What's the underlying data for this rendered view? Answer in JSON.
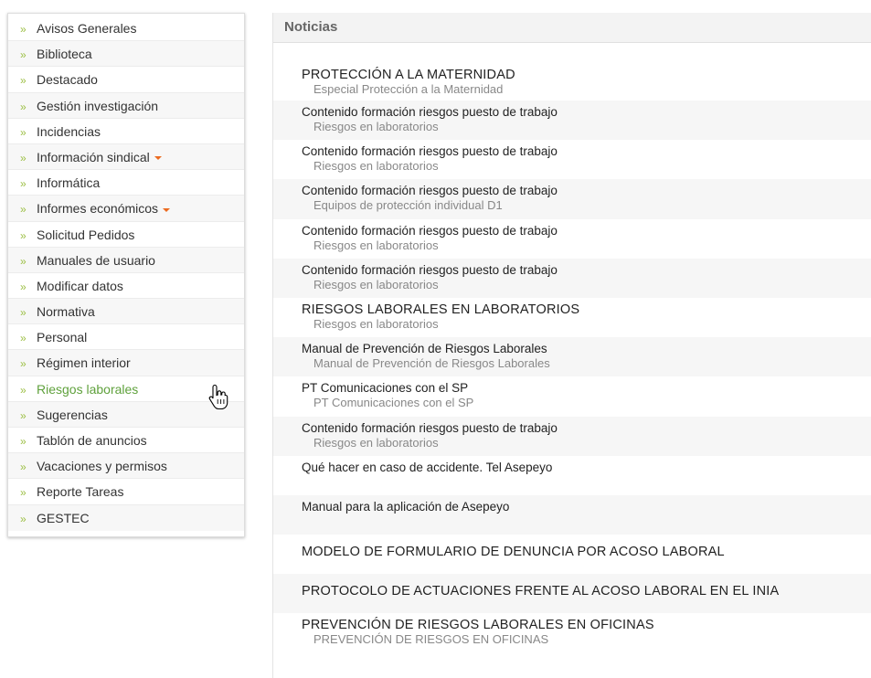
{
  "sidebar": {
    "items": [
      {
        "label": "Avisos Generales",
        "dropdown": false,
        "active": false
      },
      {
        "label": "Biblioteca",
        "dropdown": false,
        "active": false
      },
      {
        "label": "Destacado",
        "dropdown": false,
        "active": false
      },
      {
        "label": "Gestión investigación",
        "dropdown": false,
        "active": false
      },
      {
        "label": "Incidencias",
        "dropdown": false,
        "active": false
      },
      {
        "label": "Información sindical",
        "dropdown": true,
        "active": false
      },
      {
        "label": "Informática",
        "dropdown": false,
        "active": false
      },
      {
        "label": "Informes económicos",
        "dropdown": true,
        "active": false
      },
      {
        "label": "Solicitud Pedidos",
        "dropdown": false,
        "active": false
      },
      {
        "label": "Manuales de usuario",
        "dropdown": false,
        "active": false
      },
      {
        "label": "Modificar datos",
        "dropdown": false,
        "active": false
      },
      {
        "label": "Normativa",
        "dropdown": false,
        "active": false
      },
      {
        "label": "Personal",
        "dropdown": false,
        "active": false
      },
      {
        "label": "Régimen interior",
        "dropdown": false,
        "active": false
      },
      {
        "label": "Riesgos laborales",
        "dropdown": false,
        "active": true
      },
      {
        "label": "Sugerencias",
        "dropdown": false,
        "active": false
      },
      {
        "label": "Tablón de anuncios",
        "dropdown": false,
        "active": false
      },
      {
        "label": "Vacaciones y permisos",
        "dropdown": false,
        "active": false
      },
      {
        "label": "Reporte Tareas",
        "dropdown": false,
        "active": false
      },
      {
        "label": "GESTEC",
        "dropdown": false,
        "active": false
      }
    ],
    "bullet": "»"
  },
  "news": {
    "header": "Noticias",
    "items": [
      {
        "title": "PROTECCIÓN A LA MATERNIDAD",
        "subtitle": "Especial Protección a la Maternidad",
        "caps": true,
        "shaded": false
      },
      {
        "title": "Contenido formación riesgos puesto de trabajo",
        "subtitle": "Riesgos en laboratorios",
        "caps": false,
        "shaded": true
      },
      {
        "title": "Contenido formación riesgos puesto de trabajo",
        "subtitle": "Riesgos en laboratorios",
        "caps": false,
        "shaded": false
      },
      {
        "title": "Contenido formación riesgos puesto de trabajo",
        "subtitle": "Equipos de protección individual D1",
        "caps": false,
        "shaded": true
      },
      {
        "title": "Contenido formación riesgos puesto de trabajo",
        "subtitle": "Riesgos en laboratorios",
        "caps": false,
        "shaded": false
      },
      {
        "title": "Contenido formación riesgos puesto de trabajo",
        "subtitle": "Riesgos en laboratorios",
        "caps": false,
        "shaded": true
      },
      {
        "title": "RIESGOS LABORALES EN LABORATORIOS",
        "subtitle": "Riesgos en laboratorios",
        "caps": true,
        "shaded": false
      },
      {
        "title": "Manual de Prevención de Riesgos Laborales",
        "subtitle": "Manual de Prevención de Riesgos Laborales",
        "caps": false,
        "shaded": true
      },
      {
        "title": "PT Comunicaciones con el SP",
        "subtitle": "PT Comunicaciones con el SP",
        "caps": false,
        "shaded": false
      },
      {
        "title": "Contenido formación riesgos puesto de trabajo",
        "subtitle": "Riesgos en laboratorios",
        "caps": false,
        "shaded": true
      },
      {
        "title": "Qué hacer en caso de accidente. Tel Asepeyo",
        "subtitle": "",
        "caps": false,
        "shaded": false
      },
      {
        "title": "Manual para la aplicación de Asepeyo",
        "subtitle": "",
        "caps": false,
        "shaded": true
      },
      {
        "title": "MODELO DE FORMULARIO DE DENUNCIA POR ACOSO LABORAL",
        "subtitle": "",
        "caps": true,
        "shaded": false
      },
      {
        "title": "PROTOCOLO DE ACTUACIONES FRENTE AL ACOSO LABORAL EN EL INIA",
        "subtitle": "",
        "caps": true,
        "shaded": true
      },
      {
        "title": "PREVENCIÓN DE RIESGOS LABORALES EN OFICINAS",
        "subtitle": "PREVENCIÓN DE RIESGOS EN OFICINAS",
        "caps": true,
        "shaded": false
      }
    ]
  },
  "colors": {
    "accent_green": "#5fa13c",
    "bullet_green": "#9cbf44",
    "caret_orange": "#ec6a1f"
  },
  "icons": {
    "cursor": "hand-pointer-icon"
  }
}
